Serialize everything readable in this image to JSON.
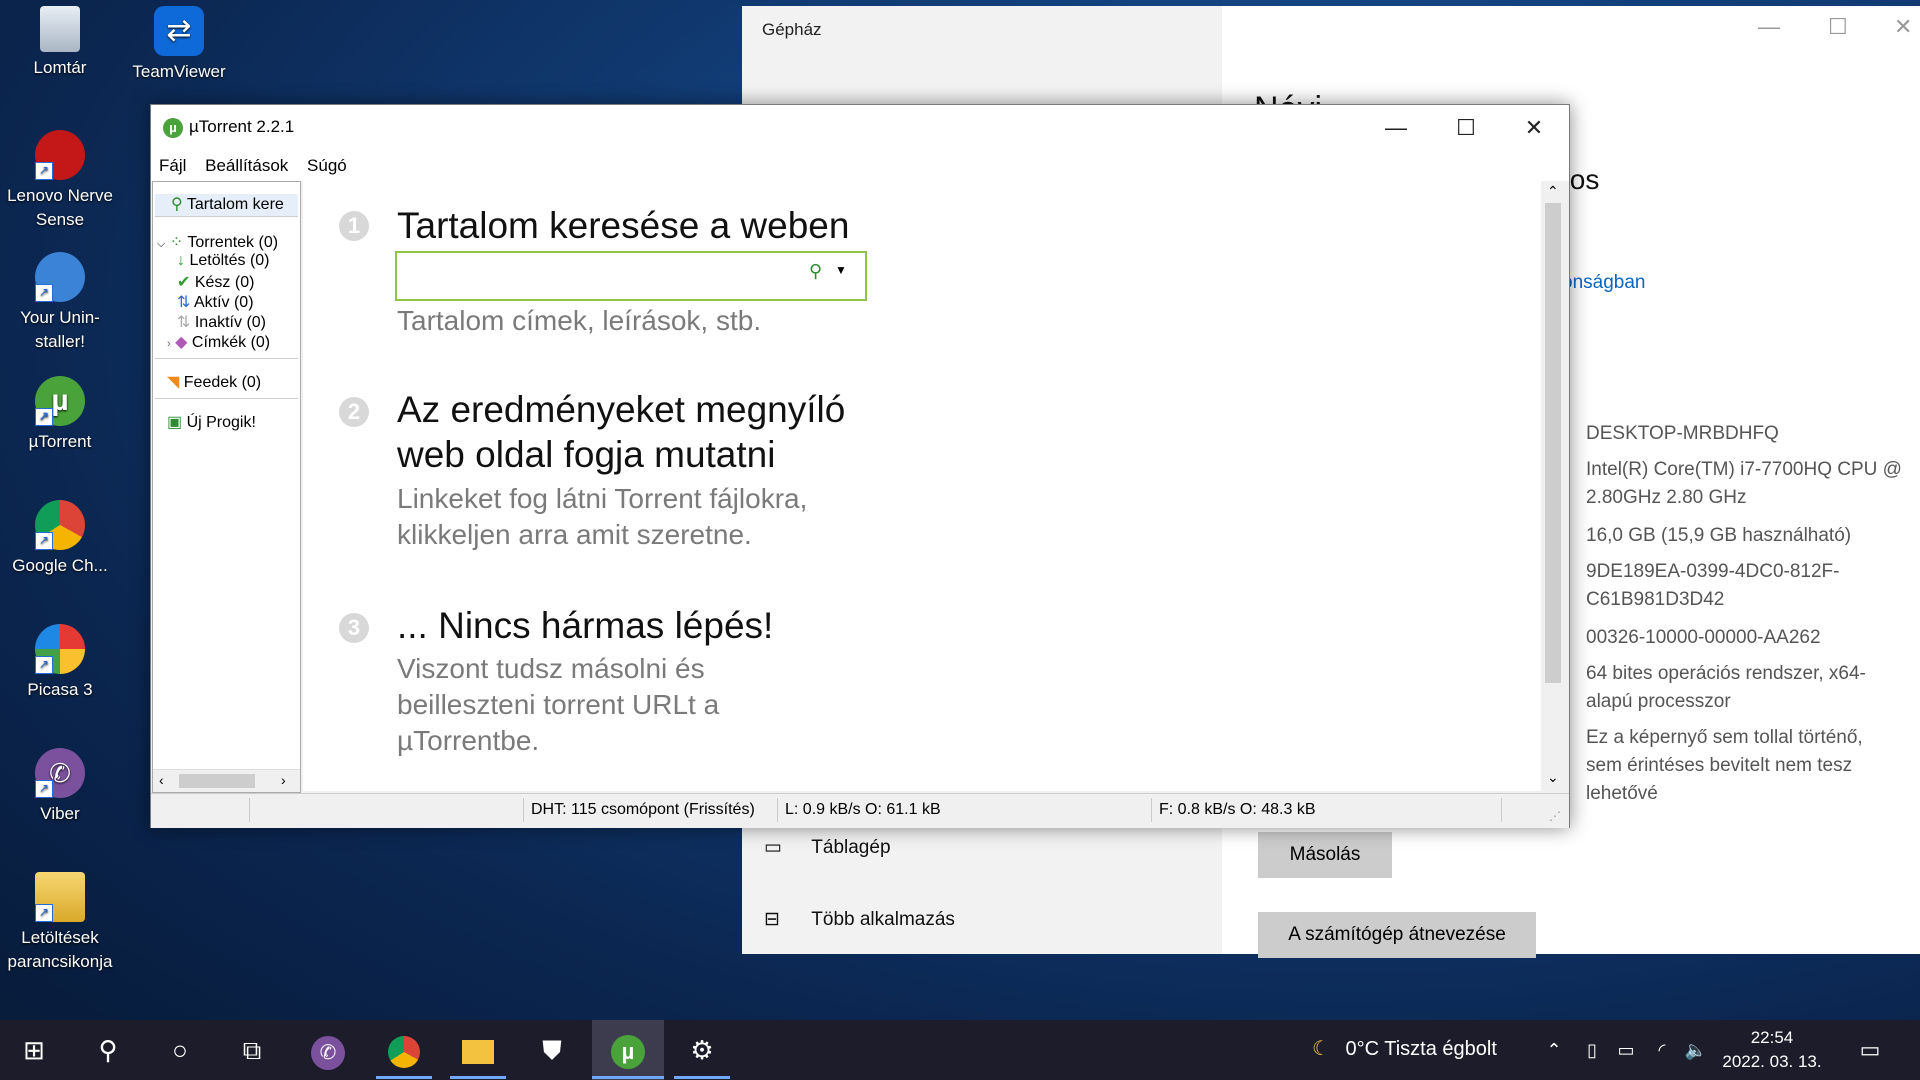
{
  "desktop": {
    "icons": [
      {
        "label": "Lomtár"
      },
      {
        "label": "TeamViewer"
      },
      {
        "label": "Lenovo Nerve Sense"
      },
      {
        "label": "Your Unin-staller!"
      },
      {
        "label": "µTorrent"
      },
      {
        "label": "Google Ch..."
      },
      {
        "label": "Picasa 3"
      },
      {
        "label": "Viber"
      },
      {
        "label": "Letöltések parancsikonja"
      }
    ]
  },
  "settings": {
    "title": "Gépház",
    "partial_heading": "Névj",
    "partial_heading2": "tos",
    "link": "onságban",
    "specs": [
      "DESKTOP-MRBDHFQ",
      "Intel(R) Core(TM) i7-7700HQ CPU @ 2.80GHz   2.80 GHz",
      "16,0 GB (15,9 GB használható)",
      "9DE189EA-0399-4DC0-812F-C61B981D3D42",
      "00326-10000-00000-AA262",
      "64 bites operációs rendszer, x64-alapú processzor",
      "Ez a képernyő sem tollal történő, sem érintéses bevitelt nem tesz lehetővé"
    ],
    "nav": [
      {
        "label": "Táblagép"
      },
      {
        "label": "Több alkalmazás"
      }
    ],
    "copy_button": "Másolás",
    "rename_button": "A számítógép átnevezése"
  },
  "utorrent": {
    "title": "µTorrent 2.2.1",
    "menu": [
      "Fájl",
      "Beállítások",
      "Súgó"
    ],
    "sidebar": {
      "search": "Tartalom kere",
      "torrents": "Torrentek (0)",
      "downloading": "Letöltés (0)",
      "done": "Kész (0)",
      "active": "Aktív (0)",
      "inactive": "Inaktív (0)",
      "labels": "Címkék (0)",
      "feeds": "Feedek (0)",
      "apps": "Új Progik!"
    },
    "steps": [
      {
        "num": "1",
        "heading": "Tartalom keresése a weben",
        "sub": "Tartalom címek, leírások, stb."
      },
      {
        "num": "2",
        "heading_line1": "Az eredményeket megnyíló",
        "heading_line2": "web oldal fogja mutatni",
        "sub_line1": "Linkeket fog látni Torrent fájlokra,",
        "sub_line2": "klikkeljen arra amit szeretne."
      },
      {
        "num": "3",
        "heading": "... Nincs hármas lépés!",
        "sub_line1": "Viszont tudsz másolni és",
        "sub_line2": "beilleszteni torrent URLt a",
        "sub_line3": "µTorrentbe."
      }
    ],
    "search_value": "",
    "status": {
      "dht": "DHT: 115 csomópont (Frissítés)",
      "download": "L: 0.9 kB/s O: 61.1 kB",
      "upload": "F: 0.8 kB/s O: 48.3 kB"
    }
  },
  "taskbar": {
    "weather": "0°C  Tiszta égbolt",
    "time": "22:54",
    "date": "2022. 03. 13."
  }
}
